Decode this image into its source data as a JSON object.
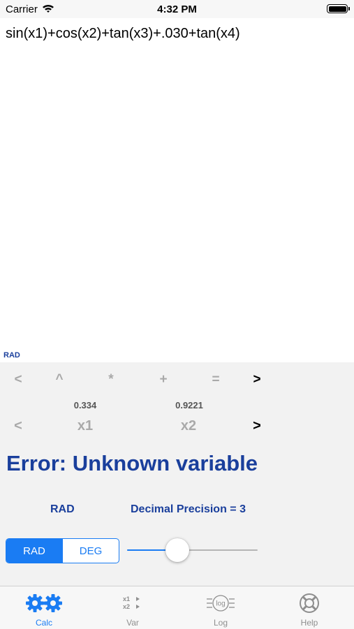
{
  "status": {
    "carrier": "Carrier",
    "time": "4:32 PM"
  },
  "expression": "sin(x1)+cos(x2)+tan(x3)+.030+tan(x4)",
  "mode_label": "RAD",
  "keypad": {
    "op_row": [
      "<",
      "^",
      "*",
      "+",
      "=",
      ">"
    ],
    "values": [
      "0.334",
      "0.9221"
    ],
    "var_row": [
      "<",
      "x1",
      "x2",
      ">"
    ]
  },
  "error_message": "Error: Unknown variable",
  "info": {
    "mode": "RAD",
    "precision": "Decimal Precision = 3"
  },
  "angle_toggle": {
    "options": [
      "RAD",
      "DEG"
    ],
    "selected": "RAD"
  },
  "precision_slider": {
    "fraction": 0.36
  },
  "tabs": [
    {
      "label": "Calc",
      "icon": "gears-icon",
      "active": true
    },
    {
      "label": "Var",
      "icon": "variables-icon",
      "active": false
    },
    {
      "label": "Log",
      "icon": "log-icon",
      "active": false
    },
    {
      "label": "Help",
      "icon": "lifebuoy-icon",
      "active": false
    }
  ],
  "colors": {
    "accent": "#1a7cf3",
    "heading_blue": "#1a3f9c",
    "key_gray": "#a9a9a9"
  }
}
